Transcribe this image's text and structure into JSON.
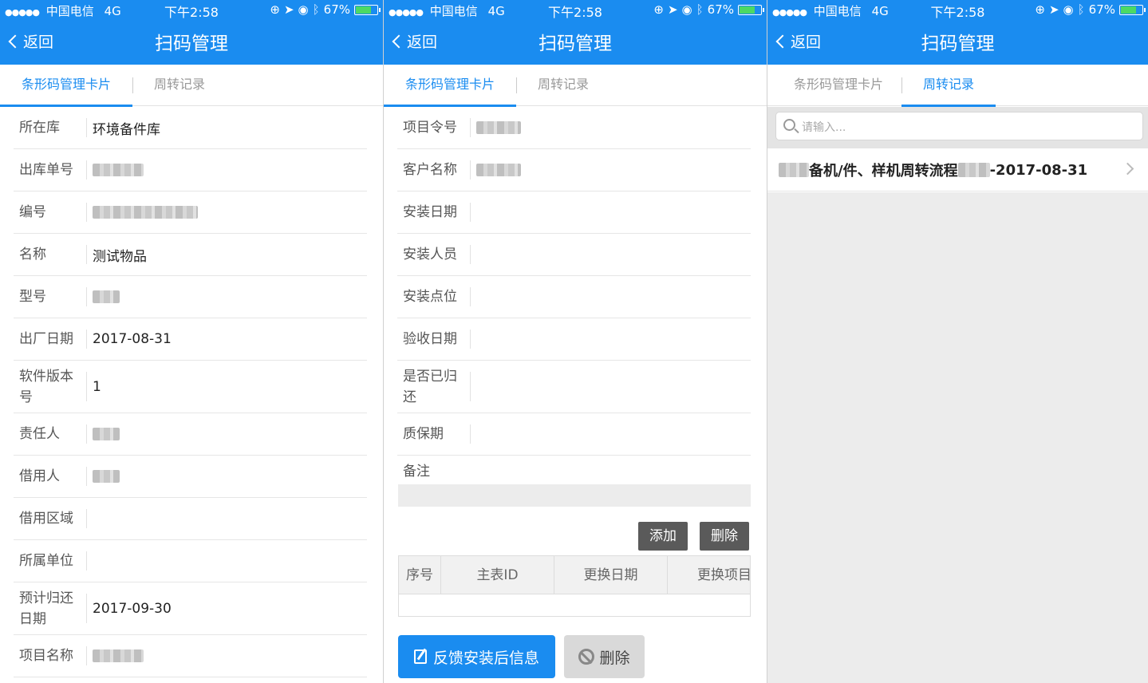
{
  "status_bar": {
    "carrier": "中国电信",
    "network": "4G",
    "time": "下午2:58",
    "battery": "67%"
  },
  "nav": {
    "back_label": "返回",
    "title": "扫码管理"
  },
  "tabs": {
    "card": "条形码管理卡片",
    "records": "周转记录"
  },
  "panel1": {
    "rows": [
      {
        "label": "所在库",
        "value": "环境备件库"
      },
      {
        "label": "出库单号",
        "value": ""
      },
      {
        "label": "编号",
        "value": ""
      },
      {
        "label": "名称",
        "value": "测试物品"
      },
      {
        "label": "型号",
        "value": ""
      },
      {
        "label": "出厂日期",
        "value": "2017-08-31"
      },
      {
        "label": "软件版本号",
        "value": "1"
      },
      {
        "label": "责任人",
        "value": ""
      },
      {
        "label": "借用人",
        "value": ""
      },
      {
        "label": "借用区域",
        "value": ""
      },
      {
        "label": "所属单位",
        "value": ""
      },
      {
        "label": "预计归还日期",
        "value": "2017-09-30"
      },
      {
        "label": "项目名称",
        "value": ""
      }
    ]
  },
  "panel2": {
    "rows": [
      {
        "label": "项目令号",
        "value": ""
      },
      {
        "label": "客户名称",
        "value": ""
      },
      {
        "label": "安装日期",
        "value": ""
      },
      {
        "label": "安装人员",
        "value": ""
      },
      {
        "label": "安装点位",
        "value": ""
      },
      {
        "label": "验收日期",
        "value": ""
      },
      {
        "label": "是否已归还",
        "value": ""
      },
      {
        "label": "质保期",
        "value": ""
      },
      {
        "label": "备注",
        "value": ""
      }
    ],
    "add_label": "添加",
    "delete_label": "删除",
    "table_headers": [
      "序号",
      "主表ID",
      "更换日期",
      "更换项目"
    ],
    "feedback_label": "反馈安装后信息",
    "delete_main_label": "删除"
  },
  "panel3": {
    "search_placeholder": "请输入...",
    "items": [
      {
        "text_main": "备机/件、样机周转流程",
        "date": "-2017-08-31"
      }
    ]
  }
}
